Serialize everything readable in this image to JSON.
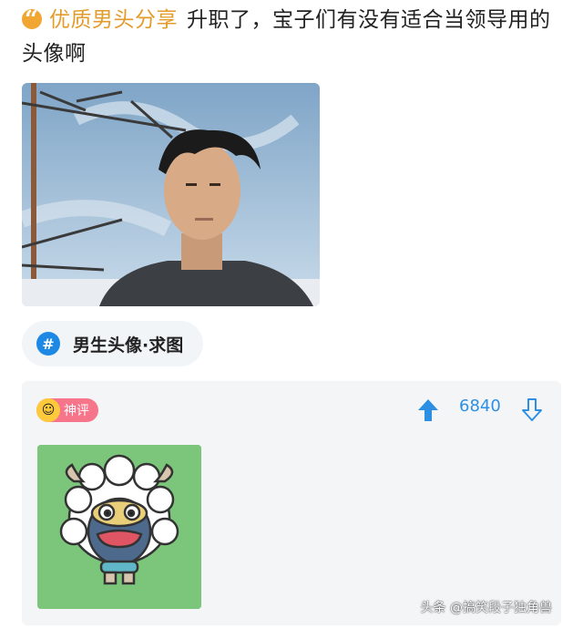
{
  "post": {
    "category": "优质男头分享",
    "title": "升职了，宝子们有没有适合当领导用的头像啊"
  },
  "topic": {
    "label": "男生头像·求图"
  },
  "comment": {
    "badge_label": "神评",
    "upvotes": "6840"
  },
  "watermark": "头条 @搞笑段子独角兽",
  "colors": {
    "accent_orange": "#e39b2a",
    "accent_blue": "#1e88e5",
    "badge_pink": "#f7758a",
    "card_bg": "#f4f5f7",
    "sticker_green": "#7cc67c"
  },
  "icons": [
    "quote-icon",
    "hashtag-icon",
    "upvote-arrow-icon",
    "downvote-arrow-icon",
    "smile-emoji-icon"
  ]
}
